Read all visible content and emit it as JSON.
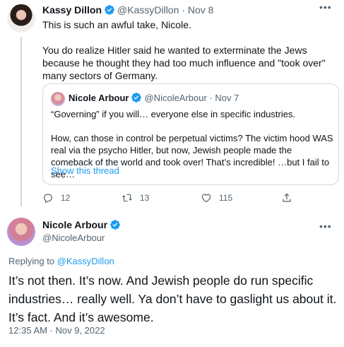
{
  "tweet": {
    "author_name": "Kassy Dillon",
    "author_handle": "@KassyDillon",
    "date": "Nov 8",
    "text": [
      "This is such an awful take, Nicole.",
      "You do realize Hitler said he wanted to exterminate the Jews because he thought they had too much influence and \"took over\" many sectors of Germany."
    ],
    "quoted": {
      "author_name": "Nicole Arbour",
      "author_handle": "@NicoleArbour",
      "date": "Nov 7",
      "text": [
        "“Governing” if you will… everyone else in specific industries.",
        "How, can those in control be perpetual victims? The victim hood WAS real via the psycho Hitler, but now, Jewish people made the comeback of the world and took over! That’s incredible! …but I fail to see…"
      ],
      "show_thread": "Show this thread"
    },
    "actions": {
      "replies": "12",
      "retweets": "13",
      "likes": "115"
    }
  },
  "reply": {
    "author_name": "Nicole Arbour",
    "author_handle": "@NicoleArbour",
    "replying_to_label": "Replying to",
    "replying_to_handle": "@KassyDillon",
    "text": "It’s not then. It’s now. And Jewish people do run specific industries… really well. Ya don’t have to gaslight us about it.  It’s fact. And it’s awesome.",
    "timestamp": "12:35 AM · Nov 9, 2022"
  },
  "colors": {
    "accent": "#1d9bf0",
    "muted": "#536471",
    "text": "#0f1419",
    "border": "#cfd9de"
  }
}
